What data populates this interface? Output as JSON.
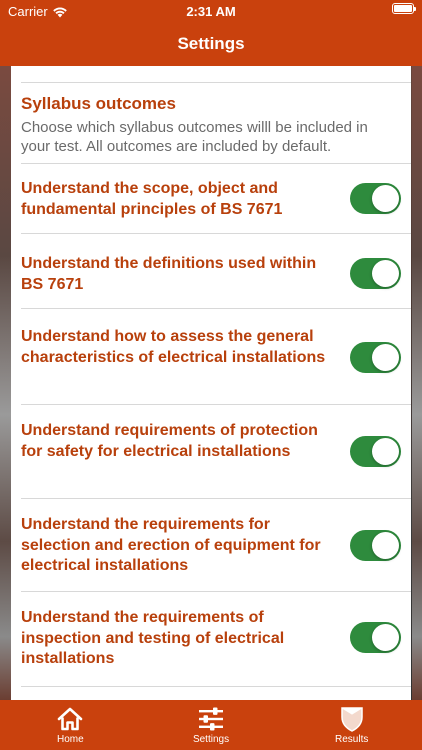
{
  "status": {
    "carrier": "Carrier",
    "time": "2:31 AM"
  },
  "nav": {
    "title": "Settings"
  },
  "syllabus": {
    "title": "Syllabus outcomes",
    "description": "Choose which syllabus outcomes willl be included in your test. All outcomes are included by default."
  },
  "outcomes": [
    {
      "label": "Understand the scope, object and fundamental principles of BS 7671",
      "enabled": true
    },
    {
      "label": "Understand the definitions used within BS 7671",
      "enabled": true
    },
    {
      "label": "Understand how to assess the general characteristics of electrical installations",
      "enabled": true
    },
    {
      "label": "Understand requirements of protection for safety for electrical installations",
      "enabled": true
    },
    {
      "label": "Understand the requirements for selection and erection of equipment for electrical installations",
      "enabled": true
    },
    {
      "label": "Understand the requirements of inspection and testing of electrical installations",
      "enabled": true
    }
  ],
  "tabs": [
    {
      "label": "Home",
      "icon": "home-icon"
    },
    {
      "label": "Settings",
      "icon": "sliders-icon"
    },
    {
      "label": "Results",
      "icon": "shield-icon"
    }
  ],
  "colors": {
    "brand": "#c9410d",
    "accent_text": "#b8400c",
    "toggle_on": "#2e8b3d"
  }
}
